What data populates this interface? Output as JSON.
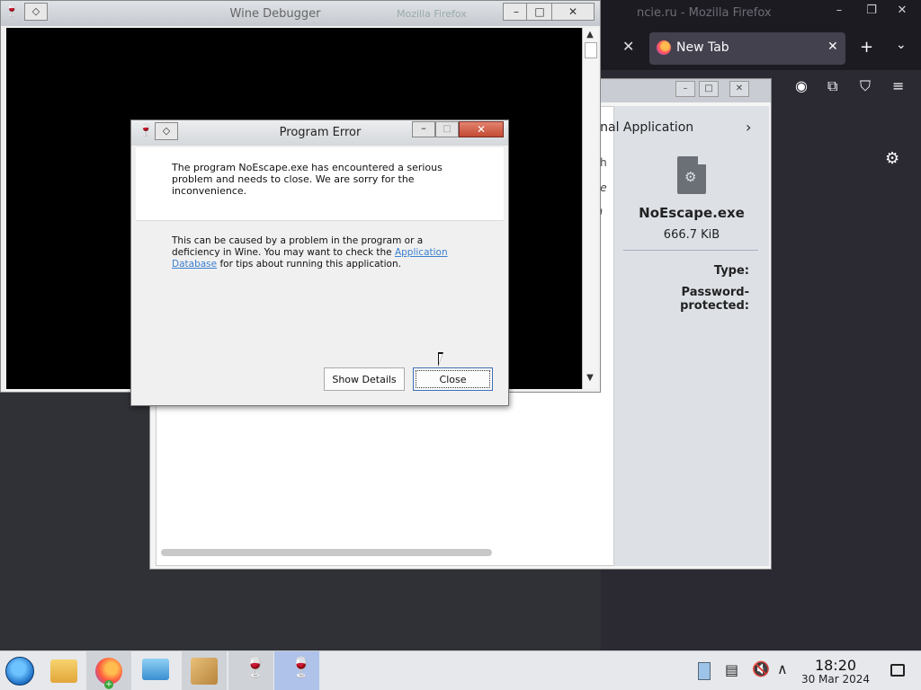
{
  "firefox": {
    "window_title_ghost": "ncie.ru - Mozilla Firefox",
    "tab_label": "New Tab",
    "close_glyph": "✕",
    "newtab_glyph": "+",
    "list_tabs_glyph": "⌄",
    "window_buttons": [
      "–",
      "❐",
      "✕"
    ],
    "toolbar_icons": [
      "download-icon",
      "account-icon",
      "extensions-icon",
      "ublock-icon",
      "menu-icon"
    ],
    "toolbar_glyphs": [
      "⤓",
      "◉",
      "⧉",
      "⛉",
      "≡"
    ],
    "gear_glyph": "⚙"
  },
  "archive_window": {
    "window_buttons": [
      "–",
      "□",
      "✕"
    ],
    "open_with_label": "ernal Application",
    "chevron": "›",
    "partial_rows": [
      "eth",
      "ore",
      "fla"
    ],
    "file_name": "NoEscape.exe",
    "file_size": "666.7 KiB",
    "type_label": "Type:",
    "password_label": "Password-protected:"
  },
  "debugger": {
    "title": "Wine Debugger",
    "ghost_title": "Mozilla Firefox",
    "sys_glyph": "◇",
    "window_buttons": [
      "–",
      "□",
      "✕"
    ],
    "scroll_up": "▲",
    "scroll_down": "▼"
  },
  "error_dialog": {
    "title": "Program Error",
    "sys_glyph": "◇",
    "min_glyph": "–",
    "max_glyph": "□",
    "close_glyph": "✕",
    "message_primary": "The program NoEscape.exe has encountered a serious problem and needs to close. We are sorry for the inconvenience.",
    "message_secondary_before": "This can be caused by a problem in the program or a deficiency in Wine. You may want to check the ",
    "link_text": "Application Database",
    "message_secondary_after": " for tips about running this application.",
    "show_details_label": "Show Details",
    "close_label": "Close"
  },
  "taskbar": {
    "clock_time": "18:20",
    "clock_date": "30 Mar 2024",
    "wine_glyph": "🍷",
    "plus_glyph": "+",
    "tray_notes": "▤",
    "tray_volume": "🔇",
    "tray_arrow": "∧"
  }
}
